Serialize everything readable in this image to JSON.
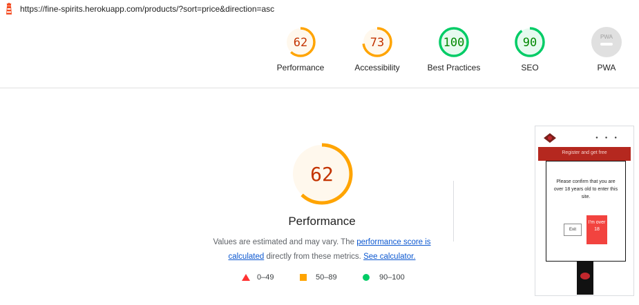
{
  "url": "https://fine-spirits.herokuapp.com/products/?sort=price&direction=asc",
  "colors": {
    "average": "#ffa400",
    "average_text": "#c33300",
    "average_bg": "#fff8ed",
    "pass": "#0c6",
    "pass_text": "#008800",
    "pass_bg": "#e6faef",
    "pwa": "#cccccc",
    "link": "#0b57d0"
  },
  "gauges": [
    {
      "name": "performance",
      "score": 62,
      "label": "Performance",
      "status": "average"
    },
    {
      "name": "accessibility",
      "score": 73,
      "label": "Accessibility",
      "status": "average"
    },
    {
      "name": "best-practices",
      "score": 100,
      "label": "Best Practices",
      "status": "pass"
    },
    {
      "name": "seo",
      "score": 90,
      "label": "SEO",
      "status": "pass"
    },
    {
      "name": "pwa",
      "score": null,
      "label": "PWA",
      "badge_text": "PWA",
      "status": "na"
    }
  ],
  "main": {
    "score": 62,
    "title": "Performance",
    "desc_prefix": "Values are estimated and may vary. The ",
    "link_score": "performance score is calculated",
    "desc_mid": " directly from these metrics. ",
    "link_calc": "See calculator."
  },
  "legend": [
    {
      "shape": "triangle",
      "range": "0–49"
    },
    {
      "shape": "square",
      "range": "50–89"
    },
    {
      "shape": "circle",
      "range": "90–100"
    }
  ],
  "screenshot": {
    "banner": "Register and get free",
    "modal_text": "Please confirm that you are over 18 years old to enter this site.",
    "exit_label": "Exit",
    "over_label": "I'm over 18"
  }
}
